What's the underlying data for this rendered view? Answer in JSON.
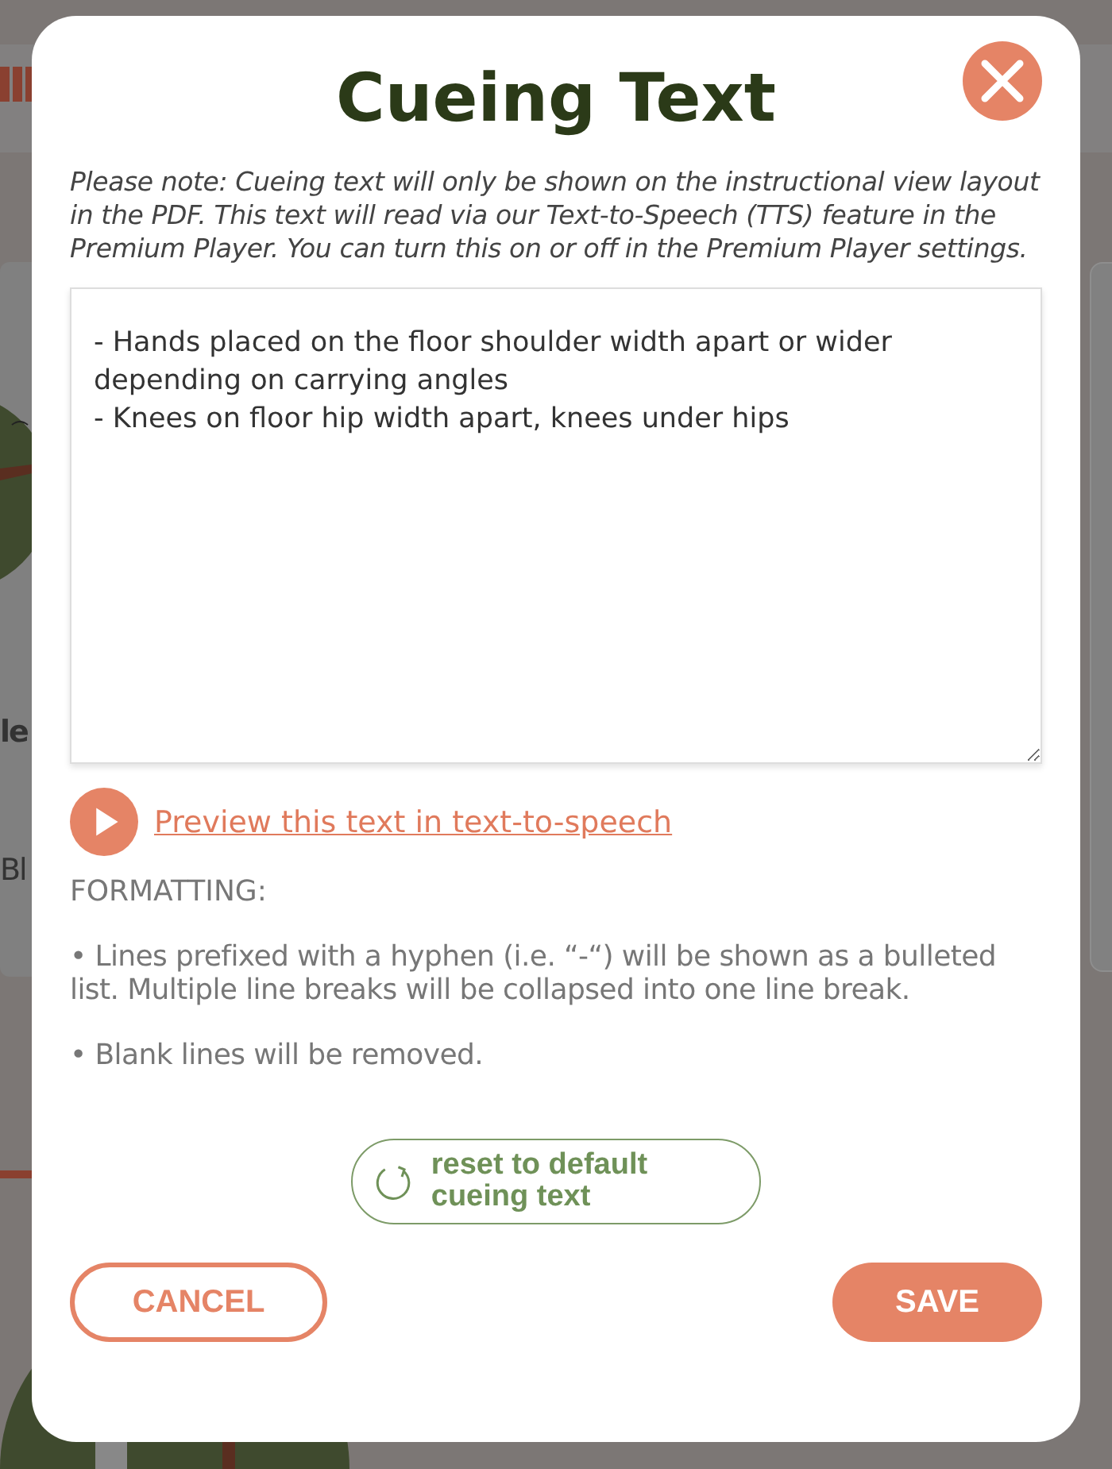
{
  "background": {
    "texts": [
      "le",
      "Bl"
    ]
  },
  "modal": {
    "title": "Cueing Text",
    "note": "Please note: Cueing text will only be shown on the instructional view layout in the PDF. This text will read via our Text-to-Speech (TTS) feature in the Premium Player. You can turn this on or off in the Premium Player settings.",
    "cueing_text": "- Hands placed on the floor shoulder width apart or wider depending on carrying angles\n- Knees on floor hip width apart, knees under hips",
    "preview_link": "Preview this text in text-to-speech",
    "formatting_heading": "FORMATTING:",
    "formatting_rules": [
      "• Lines prefixed with a hyphen (i.e. “-“) will be shown as a bulleted list. Multiple line breaks will be collapsed into one line break.",
      "• Blank lines will be removed."
    ],
    "reset_button": "reset to default cueing text",
    "buttons": [
      {
        "label": "CANCEL",
        "kind": "outline"
      },
      {
        "label": "SAVE",
        "kind": "filled"
      }
    ]
  }
}
